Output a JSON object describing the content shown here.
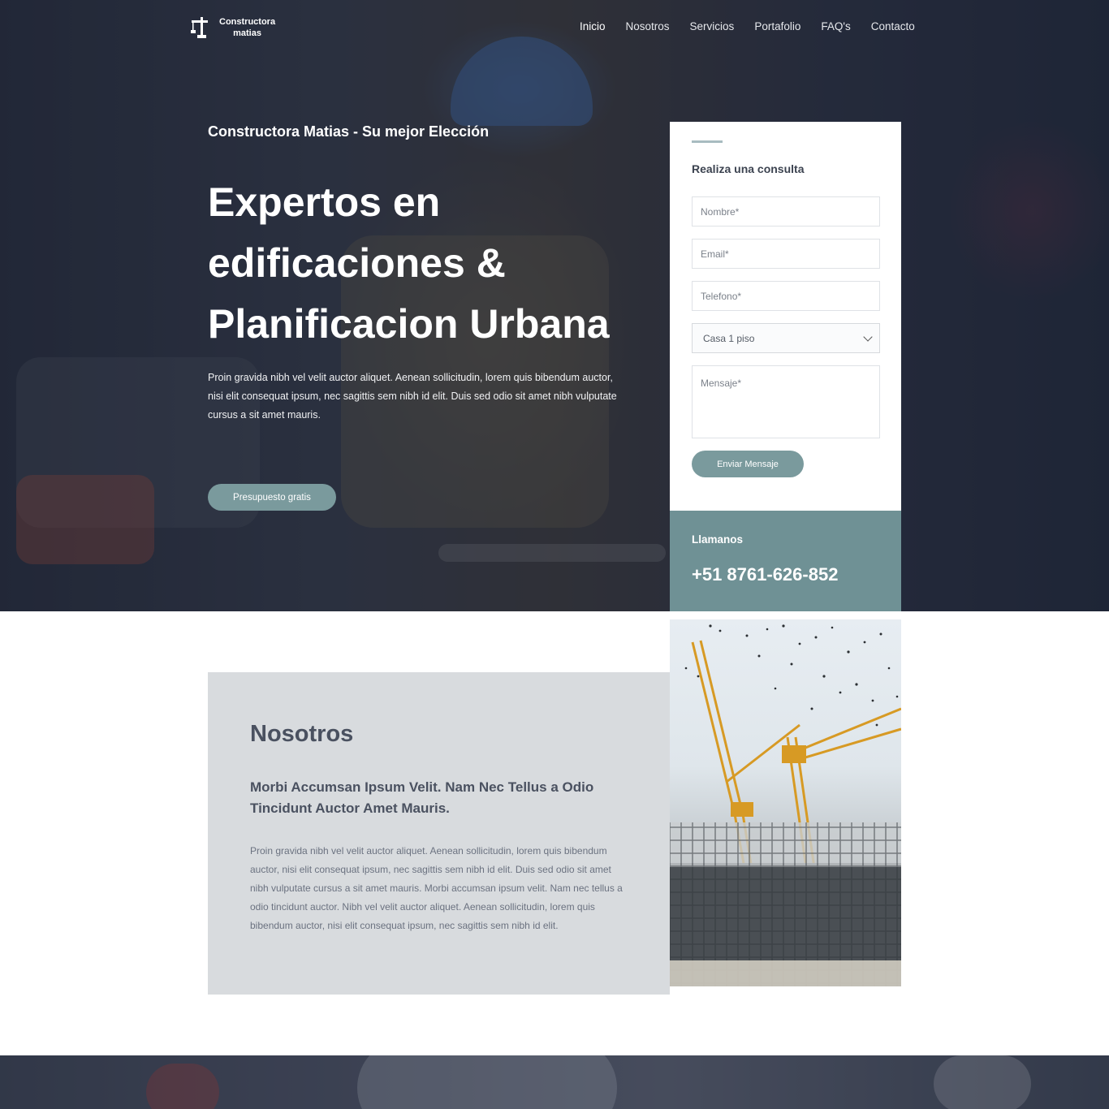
{
  "brand": {
    "name_line1": "Constructora",
    "name_line2": "matias",
    "icon": "crane-icon"
  },
  "nav": {
    "items": [
      {
        "label": "Inicio",
        "active": true
      },
      {
        "label": "Nosotros",
        "active": false
      },
      {
        "label": "Servicios",
        "active": false
      },
      {
        "label": "Portafolio",
        "active": false
      },
      {
        "label": "FAQ's",
        "active": false
      },
      {
        "label": "Contacto",
        "active": false
      }
    ]
  },
  "hero": {
    "kicker": "Constructora Matias - Su mejor Elección",
    "headline": "Expertos en edificaciones & Planificacion Urbana",
    "text": "Proin gravida nibh vel velit auctor aliquet. Aenean sollicitudin, lorem quis bibendum auctor, nisi elit consequat ipsum, nec sagittis sem nibh id elit. Duis sed odio sit amet nibh vulputate cursus a sit amet mauris.",
    "cta_label": "Presupuesto gratis"
  },
  "contact_form": {
    "title": "Realiza una consulta",
    "name_placeholder": "Nombre*",
    "email_placeholder": "Email*",
    "phone_placeholder": "Telefono*",
    "type_selected": "Casa 1 piso",
    "message_placeholder": "Mensaje*",
    "submit_label": "Enviar Mensaje"
  },
  "call": {
    "label": "Llamanos",
    "number": "+51 8761-626-852"
  },
  "about": {
    "title": "Nosotros",
    "subtitle": "Morbi Accumsan Ipsum Velit. Nam Nec Tellus a Odio Tincidunt Auctor Amet Mauris.",
    "text": "Proin gravida nibh vel velit auctor aliquet. Aenean sollicitudin, lorem quis bibendum auctor, nisi elit consequat ipsum, nec sagittis sem nibh id elit. Duis sed odio sit amet nibh vulputate cursus a sit amet mauris. Morbi accumsan ipsum velit. Nam nec tellus a odio tincidunt auctor. Nibh vel velit auctor aliquet. Aenean sollicitudin, lorem quis bibendum auctor, nisi elit consequat ipsum, nec sagittis sem nibh id elit."
  },
  "colors": {
    "accent": "#7a9a9d",
    "call_bg": "#6f9195",
    "about_bg": "#d8dbde",
    "heading_dark": "#4a5160"
  }
}
